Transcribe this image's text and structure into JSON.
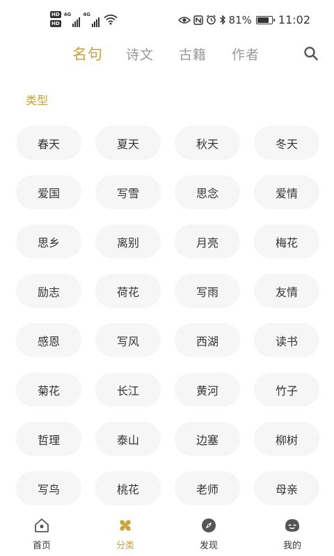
{
  "status_bar": {
    "hd1": "HD",
    "hd2": "HD",
    "net1": "4G",
    "net2": "4G",
    "battery_text": "81%",
    "battery_level": 0.81,
    "time": "11:02"
  },
  "top_tabs": [
    {
      "label": "名句",
      "active": true
    },
    {
      "label": "诗文",
      "active": false
    },
    {
      "label": "古籍",
      "active": false
    },
    {
      "label": "作者",
      "active": false
    }
  ],
  "section_title": "类型",
  "categories": [
    "春天",
    "夏天",
    "秋天",
    "冬天",
    "爱国",
    "写雪",
    "思念",
    "爱情",
    "思乡",
    "离别",
    "月亮",
    "梅花",
    "励志",
    "荷花",
    "写雨",
    "友情",
    "感恩",
    "写风",
    "西湖",
    "读书",
    "菊花",
    "长江",
    "黄河",
    "竹子",
    "哲理",
    "泰山",
    "边塞",
    "柳树",
    "写鸟",
    "桃花",
    "老师",
    "母亲"
  ],
  "bottom_nav": [
    {
      "label": "首页",
      "icon": "home-icon",
      "active": false
    },
    {
      "label": "分类",
      "icon": "category-icon",
      "active": true
    },
    {
      "label": "发现",
      "icon": "compass-icon",
      "active": false
    },
    {
      "label": "我的",
      "icon": "profile-icon",
      "active": false
    }
  ],
  "colors": {
    "accent": "#c9a23c",
    "chip_bg": "#f6f6f6",
    "text": "#333333",
    "inactive_tab": "#999999"
  }
}
